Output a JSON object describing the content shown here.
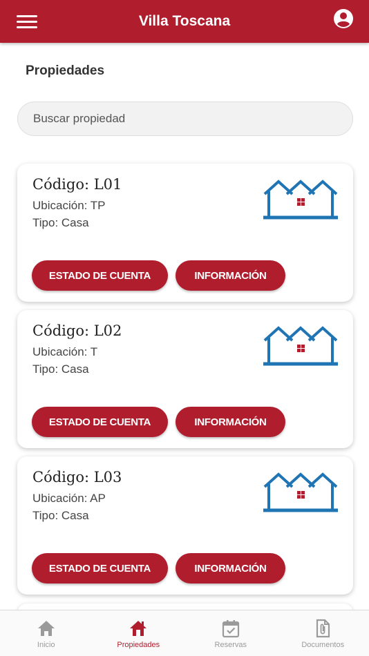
{
  "header": {
    "title": "Villa Toscana",
    "menu_icon": "hamburger-menu-icon",
    "account_icon": "account-circle-icon"
  },
  "page": {
    "title": "Propiedades"
  },
  "search": {
    "placeholder": "Buscar propiedad",
    "value": ""
  },
  "properties": [
    {
      "code": "Código: L01",
      "location": "Ubicación: TP",
      "type": "Tipo: Casa",
      "icon": "houses-icon"
    },
    {
      "code": "Código: L02",
      "location": "Ubicación: T",
      "type": "Tipo: Casa",
      "icon": "houses-icon"
    },
    {
      "code": "Código: L03",
      "location": "Ubicación: AP",
      "type": "Tipo: Casa",
      "icon": "houses-icon"
    }
  ],
  "buttons": {
    "account_statement": "ESTADO DE CUENTA",
    "information": "INFORMACIÓN"
  },
  "bottom_nav": {
    "items": [
      {
        "label": "Inicio",
        "icon": "home-icon",
        "active": false
      },
      {
        "label": "Propiedades",
        "icon": "house-icon",
        "active": true
      },
      {
        "label": "Reservas",
        "icon": "calendar-check-icon",
        "active": false
      },
      {
        "label": "Documentos",
        "icon": "document-clip-icon",
        "active": false
      }
    ]
  },
  "colors": {
    "primary": "#b01e2e",
    "house_icon": "#1f74b3",
    "nav_inactive": "#9a9a9a"
  }
}
